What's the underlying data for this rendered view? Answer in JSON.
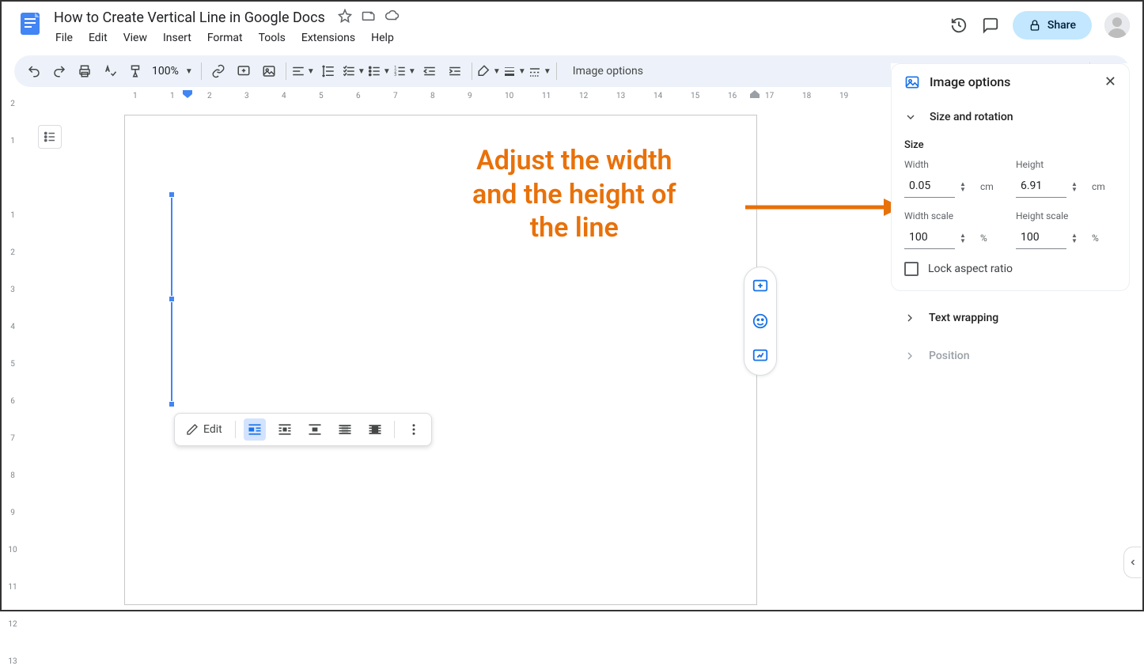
{
  "doc": {
    "title": "How to Create Vertical Line in Google Docs"
  },
  "menus": {
    "file": "File",
    "edit": "Edit",
    "view": "View",
    "insert": "Insert",
    "format": "Format",
    "tools": "Tools",
    "extensions": "Extensions",
    "help": "Help"
  },
  "header": {
    "share": "Share"
  },
  "toolbar": {
    "zoom": "100%",
    "image_options": "Image options"
  },
  "floating": {
    "edit": "Edit"
  },
  "annotation": {
    "line1": "Adjust the width",
    "line2": "and the height of",
    "line3": "the line"
  },
  "sidebar": {
    "title": "Image options",
    "section_size": "Size and rotation",
    "size_label": "Size",
    "width_label": "Width",
    "width_value": "0.05",
    "width_unit": "cm",
    "height_label": "Height",
    "height_value": "6.91",
    "height_unit": "cm",
    "wscale_label": "Width scale",
    "wscale_value": "100",
    "wscale_unit": "%",
    "hscale_label": "Height scale",
    "hscale_value": "100",
    "hscale_unit": "%",
    "lock": "Lock aspect ratio",
    "wrap": "Text wrapping",
    "position": "Position"
  },
  "ruler_h": [
    "1",
    "1",
    "2",
    "3",
    "4",
    "5",
    "6",
    "7",
    "8",
    "9",
    "10",
    "11",
    "12",
    "13",
    "14",
    "15",
    "16",
    "17",
    "18",
    "19"
  ],
  "ruler_v": [
    "2",
    "1",
    "",
    "1",
    "2",
    "3",
    "4",
    "5",
    "6",
    "7",
    "8",
    "9",
    "10",
    "11",
    "12",
    "13"
  ]
}
